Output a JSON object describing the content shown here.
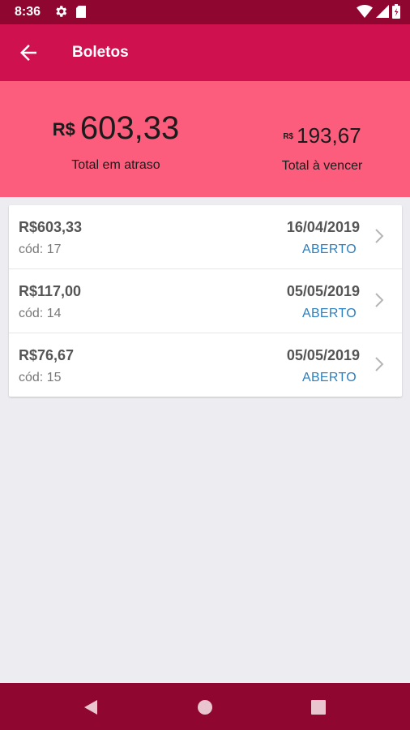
{
  "status_bar": {
    "time": "8:36",
    "icons": [
      "gear-icon",
      "sd-card-icon",
      "wifi-icon",
      "signal-icon",
      "battery-icon"
    ]
  },
  "app_bar": {
    "title": "Boletos",
    "back_icon": "arrow-left-icon"
  },
  "summary": {
    "overdue": {
      "currency": "R$",
      "amount": "603,33",
      "label": "Total em atraso"
    },
    "upcoming": {
      "currency": "R$",
      "amount": "193,67",
      "label": "Total à vencer"
    }
  },
  "boletos": [
    {
      "amount": "R$603,33",
      "code": "cód: 17",
      "date": "16/04/2019",
      "status": "ABERTO"
    },
    {
      "amount": "R$117,00",
      "code": "cód: 14",
      "date": "05/05/2019",
      "status": "ABERTO"
    },
    {
      "amount": "R$76,67",
      "code": "cód: 15",
      "date": "05/05/2019",
      "status": "ABERTO"
    }
  ],
  "nav_bar": {
    "icons": [
      "back-triangle-icon",
      "home-circle-icon",
      "recents-square-icon"
    ]
  },
  "colors": {
    "status_bar": "#8f0730",
    "app_bar": "#d01150",
    "summary_bg": "#fd5d7c",
    "status_text": "#2d7fbf",
    "page_bg": "#ededf1"
  }
}
